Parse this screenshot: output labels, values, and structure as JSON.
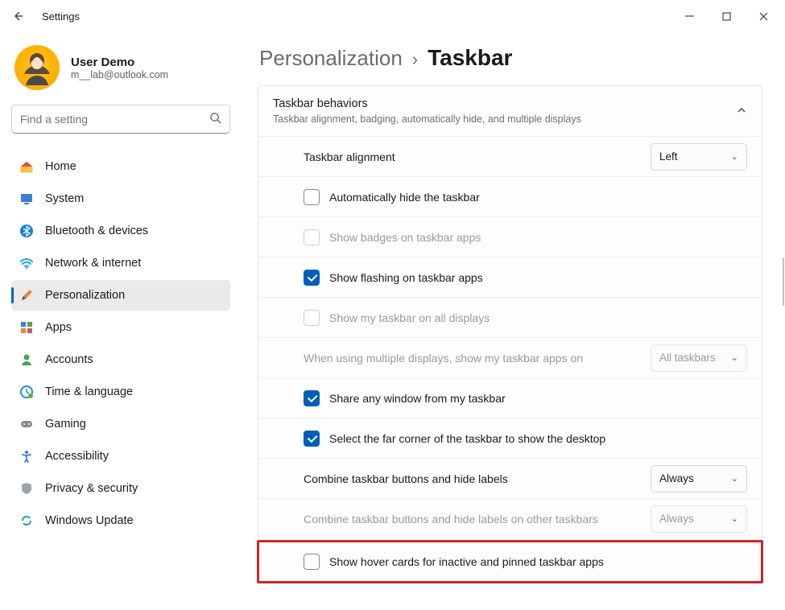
{
  "window": {
    "title": "Settings"
  },
  "user": {
    "name": "User Demo",
    "email": "m__lab@outlook.com"
  },
  "search": {
    "placeholder": "Find a setting"
  },
  "nav": {
    "home": "Home",
    "system": "System",
    "bluetooth": "Bluetooth & devices",
    "network": "Network & internet",
    "personalization": "Personalization",
    "apps": "Apps",
    "accounts": "Accounts",
    "time": "Time & language",
    "gaming": "Gaming",
    "accessibility": "Accessibility",
    "privacy": "Privacy & security",
    "update": "Windows Update"
  },
  "breadcrumb": {
    "parent": "Personalization",
    "current": "Taskbar"
  },
  "section": {
    "title": "Taskbar behaviors",
    "subtitle": "Taskbar alignment, badging, automatically hide, and multiple displays"
  },
  "rows": {
    "alignment_label": "Taskbar alignment",
    "alignment_value": "Left",
    "autohide": "Automatically hide the taskbar",
    "badges": "Show badges on taskbar apps",
    "flashing": "Show flashing on taskbar apps",
    "all_displays": "Show my taskbar on all displays",
    "multi_label": "When using multiple displays, show my taskbar apps on",
    "multi_value": "All taskbars",
    "share": "Share any window from my taskbar",
    "corner": "Select the far corner of the taskbar to show the desktop",
    "combine_label": "Combine taskbar buttons and hide labels",
    "combine_value": "Always",
    "combine_other_label": "Combine taskbar buttons and hide labels on other taskbars",
    "combine_other_value": "Always",
    "hover_cards": "Show hover cards for inactive and pinned taskbar apps"
  }
}
